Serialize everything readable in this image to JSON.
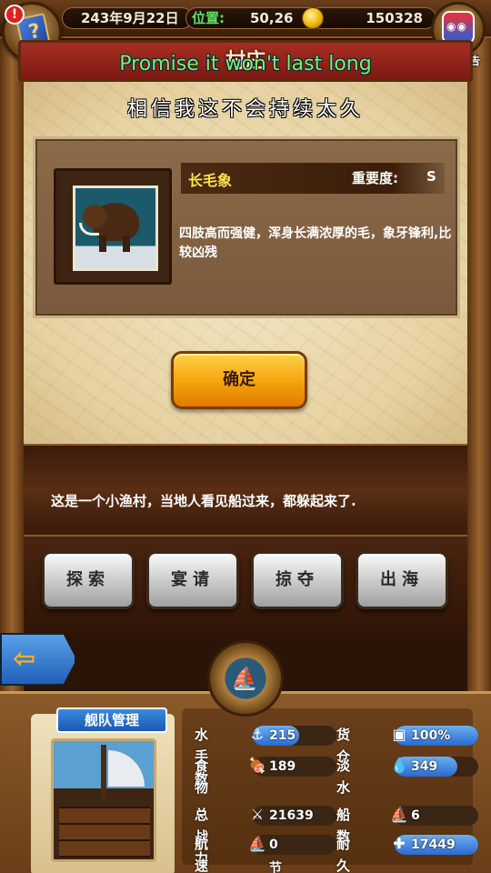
{
  "topbar": {
    "alert_badge": "!",
    "date": "243年9月22日",
    "position_label": "位置:",
    "position_value": "50,26",
    "gold": "150328",
    "ad_label": "有新广告"
  },
  "header": {
    "title": "村庄"
  },
  "subtitles": {
    "english": "Promise it won't last long",
    "chinese": "相信我这不会持续太久"
  },
  "creature": {
    "name": "长毛象",
    "importance_label": "重要度:",
    "importance_value": "S",
    "description": "四肢高而强健，浑身长满浓厚的毛，象牙锋利,比较凶残"
  },
  "confirm_label": "确定",
  "story_text": "这是一个小渔村，当地人看见船过来，都躲起来了.",
  "actions": [
    "探索",
    "宴请",
    "掠夺",
    "出海"
  ],
  "fleet": {
    "title": "舰队管理",
    "stats": [
      {
        "label": "水手数",
        "value": "215",
        "icon": "sailor-icon",
        "glyph": "⚓",
        "fill": 0.55,
        "bar": true
      },
      {
        "label": "货仓",
        "value": "100%",
        "icon": "cargo-icon",
        "glyph": "▣",
        "fill": 1.0,
        "bar": true
      },
      {
        "label": "食物",
        "value": "189",
        "icon": "food-icon",
        "glyph": "🍖",
        "fill": 0.0,
        "bar": false
      },
      {
        "label": "淡水",
        "value": "349",
        "icon": "water-icon",
        "glyph": "💧",
        "fill": 0.75,
        "bar": true
      },
      {
        "label": "总战力",
        "value": "21639",
        "icon": "power-icon",
        "glyph": "⚔",
        "fill": 0.0,
        "bar": false
      },
      {
        "label": "船数",
        "value": "6",
        "icon": "ship-count-icon",
        "glyph": "⛵",
        "fill": 0.0,
        "bar": false
      },
      {
        "label": "航速",
        "value": "0节",
        "icon": "speed-icon",
        "glyph": "⛵",
        "fill": 0.0,
        "bar": false
      },
      {
        "label": "耐久",
        "value": "17449",
        "icon": "durability-icon",
        "glyph": "✚",
        "fill": 1.0,
        "bar": true
      }
    ]
  },
  "colors": {
    "header_red": "#a82e22",
    "subtitle_green": "#7cf070",
    "creature_name": "#ffe24a",
    "confirm_orange": "#f5a20a",
    "stat_blue": "#2a6ad0"
  }
}
